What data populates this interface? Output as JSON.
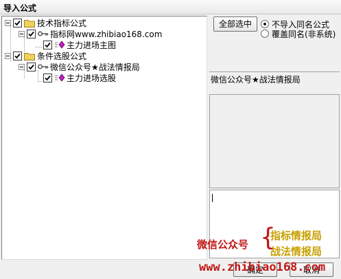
{
  "window": {
    "title": "导入公式"
  },
  "tree": {
    "nodes": [
      {
        "label": "技术指标公式"
      },
      {
        "label": "指标网www.zhibiao168.com"
      },
      {
        "label": "主力进场主图"
      },
      {
        "label": "条件选股公式"
      },
      {
        "label": "微信公众号★战法情报局"
      },
      {
        "label": "主力进场选股"
      }
    ]
  },
  "buttons": {
    "select_all": "全部选中",
    "confirm": "确定",
    "cancel": "取消"
  },
  "options": {
    "no_import_same_name": "不导入同名公式",
    "overwrite_same_name": "覆盖同名(非系统)",
    "selected": "no_import_same_name"
  },
  "detail": {
    "name_label": "微信公众号★战法情报局"
  },
  "watermark": {
    "left": "微信公众号",
    "right1": "指标情报局",
    "right2": "战法情报局",
    "url": "www.zhibiao168.com"
  },
  "colors": {
    "watermark_red": "#c01818",
    "watermark_gold": "#c8a000",
    "folder_yellow": "#f2d15a",
    "formula_magenta": "#c020c0"
  }
}
